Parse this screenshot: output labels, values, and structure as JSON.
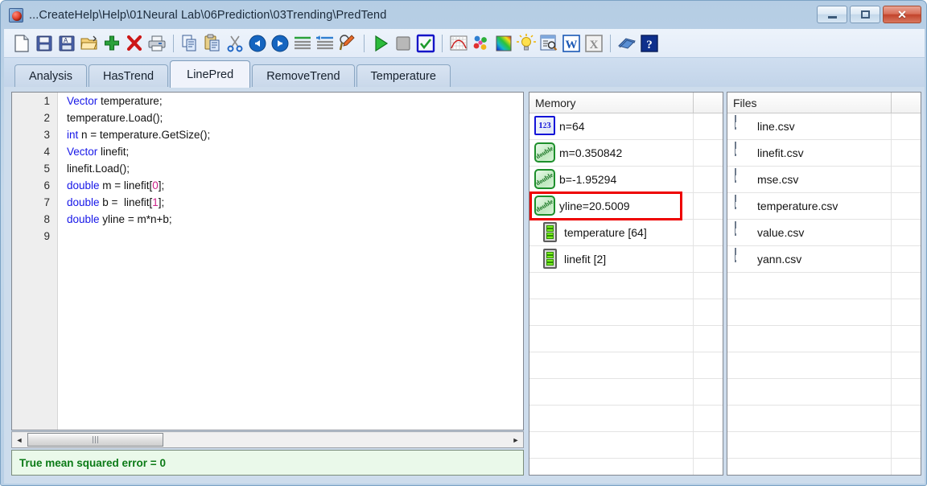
{
  "window": {
    "title": "...CreateHelp\\Help\\01Neural Lab\\06Prediction\\03Trending\\PredTend",
    "app_icon": "red-sphere-icon",
    "controls": {
      "minimize_label": "Minimize",
      "maximize_label": "Maximize",
      "close_label": "Close",
      "close_glyph": "✕",
      "close_color": "#c2432b"
    }
  },
  "toolbar": {
    "items": [
      {
        "name": "new-file-icon",
        "title": "New"
      },
      {
        "name": "save-icon",
        "title": "Save"
      },
      {
        "name": "save-as-icon",
        "title": "Save As"
      },
      {
        "name": "open-folder-icon",
        "title": "Open"
      },
      {
        "name": "add-icon",
        "title": "Add"
      },
      {
        "name": "delete-icon",
        "title": "Delete"
      },
      {
        "name": "print-icon",
        "title": "Print"
      },
      {
        "name": "separator",
        "title": ""
      },
      {
        "name": "copy-icon",
        "title": "Copy"
      },
      {
        "name": "paste-icon",
        "title": "Paste"
      },
      {
        "name": "cut-icon",
        "title": "Cut"
      },
      {
        "name": "undo-icon",
        "title": "Undo"
      },
      {
        "name": "redo-icon",
        "title": "Redo"
      },
      {
        "name": "indent-icon",
        "title": "Indent"
      },
      {
        "name": "outdent-icon",
        "title": "Outdent"
      },
      {
        "name": "find-icon",
        "title": "Find"
      },
      {
        "name": "separator",
        "title": ""
      },
      {
        "name": "run-icon",
        "title": "Run"
      },
      {
        "name": "stop-icon",
        "title": "Stop"
      },
      {
        "name": "check-icon",
        "title": "Check"
      },
      {
        "name": "separator",
        "title": ""
      },
      {
        "name": "plot-icon",
        "title": "Plot"
      },
      {
        "name": "scatter-icon",
        "title": "Scatter"
      },
      {
        "name": "colormap-icon",
        "title": "Color Map"
      },
      {
        "name": "idea-icon",
        "title": "Hint"
      },
      {
        "name": "preview-icon",
        "title": "Preview"
      },
      {
        "name": "word-export-icon",
        "title": "Export to Word"
      },
      {
        "name": "excel-export-icon",
        "title": "Export to Excel"
      },
      {
        "name": "separator",
        "title": ""
      },
      {
        "name": "book-icon",
        "title": "Manual"
      },
      {
        "name": "help-icon",
        "title": "Help"
      }
    ]
  },
  "tabs": {
    "active_index": 2,
    "items": [
      {
        "label": "Analysis"
      },
      {
        "label": "HasTrend"
      },
      {
        "label": "LinePred"
      },
      {
        "label": "RemoveTrend"
      },
      {
        "label": "Temperature"
      }
    ]
  },
  "editor": {
    "lines": [
      {
        "n": "1",
        "tokens": [
          {
            "t": "Vector",
            "c": "kw"
          },
          {
            "t": " temperature;",
            "c": ""
          }
        ]
      },
      {
        "n": "2",
        "tokens": [
          {
            "t": "temperature.Load();",
            "c": ""
          }
        ]
      },
      {
        "n": "3",
        "tokens": [
          {
            "t": "int",
            "c": "kw"
          },
          {
            "t": " n = temperature.GetSize();",
            "c": ""
          }
        ]
      },
      {
        "n": "4",
        "tokens": [
          {
            "t": "Vector",
            "c": "kw"
          },
          {
            "t": " linefit;",
            "c": ""
          }
        ]
      },
      {
        "n": "5",
        "tokens": [
          {
            "t": "linefit.Load();",
            "c": ""
          }
        ]
      },
      {
        "n": "6",
        "tokens": [
          {
            "t": "double",
            "c": "kw"
          },
          {
            "t": " m = linefit[",
            "c": ""
          },
          {
            "t": "0",
            "c": "num"
          },
          {
            "t": "];",
            "c": ""
          }
        ]
      },
      {
        "n": "7",
        "tokens": [
          {
            "t": "double",
            "c": "kw"
          },
          {
            "t": " b =  linefit[",
            "c": ""
          },
          {
            "t": "1",
            "c": "num"
          },
          {
            "t": "];",
            "c": ""
          }
        ]
      },
      {
        "n": "8",
        "tokens": [
          {
            "t": "double",
            "c": "kw"
          },
          {
            "t": " yline = m*n+b;",
            "c": ""
          }
        ]
      },
      {
        "n": "9",
        "tokens": [
          {
            "t": "",
            "c": ""
          }
        ]
      }
    ],
    "scrollbar": {
      "left_arrow": "◄",
      "right_arrow": "►"
    }
  },
  "status": {
    "text": "True mean squared error = 0",
    "color": "#0b7a16"
  },
  "memory_panel": {
    "header": "Memory",
    "highlight_row_index": 3,
    "highlight_color": "#ee0000",
    "rows": [
      {
        "icon": "int-type-icon",
        "label": "n=64",
        "indent": false
      },
      {
        "icon": "double-type-icon",
        "label": "m=0.350842",
        "indent": false
      },
      {
        "icon": "double-type-icon",
        "label": "b=-1.95294",
        "indent": false
      },
      {
        "icon": "double-type-icon",
        "label": "yline=20.5009",
        "indent": false
      },
      {
        "icon": "vector-type-icon",
        "label": "temperature [64]",
        "indent": true
      },
      {
        "icon": "vector-type-icon",
        "label": "linefit [2]",
        "indent": true
      }
    ],
    "empty_rows": 8
  },
  "files_panel": {
    "header": "Files",
    "rows": [
      {
        "icon": "csv-file-icon",
        "label": "line.csv"
      },
      {
        "icon": "csv-file-icon",
        "label": "linefit.csv"
      },
      {
        "icon": "csv-file-icon",
        "label": "mse.csv"
      },
      {
        "icon": "csv-file-icon",
        "label": "temperature.csv"
      },
      {
        "icon": "csv-file-icon",
        "label": "value.csv"
      },
      {
        "icon": "csv-file-icon",
        "label": "yann.csv"
      }
    ],
    "empty_rows": 8
  }
}
